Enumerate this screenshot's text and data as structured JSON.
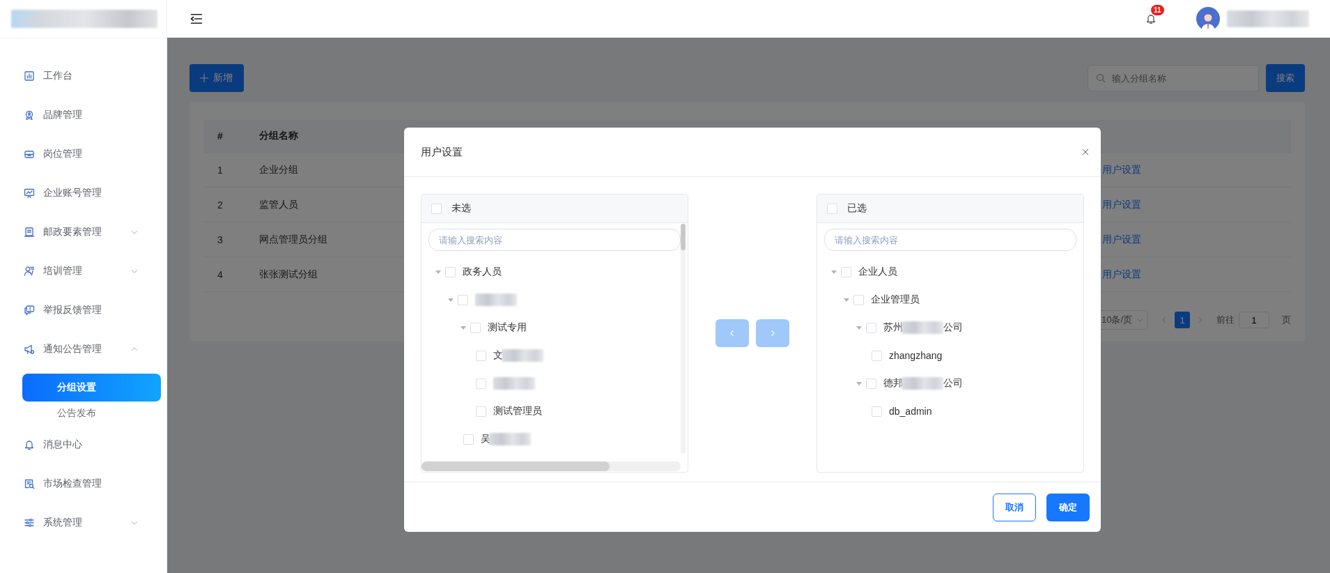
{
  "sidebar": {
    "logo": {
      "redacted": true
    },
    "items": [
      {
        "label": "工作台",
        "selected": false
      },
      {
        "label": "品牌管理",
        "selected": false
      },
      {
        "label": "岗位管理",
        "selected": false
      },
      {
        "label": "企业账号管理",
        "selected": false
      },
      {
        "label": "邮政要素管理",
        "selected": false,
        "expanded": false
      },
      {
        "label": "培训管理",
        "selected": false,
        "expanded": false
      },
      {
        "label": "举报反馈管理",
        "selected": false
      },
      {
        "label": "通知公告管理",
        "selected": false,
        "expanded": true,
        "children": [
          {
            "label": "分组设置",
            "selected": true
          },
          {
            "label": "公告发布",
            "selected": false
          }
        ]
      },
      {
        "label": "消息中心",
        "selected": false
      },
      {
        "label": "市场检查管理",
        "selected": false
      },
      {
        "label": "系统管理",
        "selected": false,
        "expanded": false
      }
    ]
  },
  "topbar": {
    "notification_count": "11",
    "user": {
      "redacted": true
    }
  },
  "toolbar": {
    "add_button": "新增",
    "search": {
      "placeholder": "输入分组名称"
    },
    "search_button": "搜索"
  },
  "table": {
    "columns": [
      "#",
      "分组名称"
    ],
    "rows": [
      {
        "index": "1",
        "name": "企业分组",
        "action": "用户设置"
      },
      {
        "index": "2",
        "name": "监管人员",
        "action": "用户设置"
      },
      {
        "index": "3",
        "name": "网点管理员分组",
        "action": "用户设置"
      },
      {
        "index": "4",
        "name": "张张测试分组",
        "action": "用户设置"
      }
    ]
  },
  "pagination": {
    "page_size": "10条/页",
    "pages": [
      {
        "label": "1",
        "selected": true
      }
    ],
    "goto_label": "前往",
    "goto_value": "1",
    "page_suffix": "页"
  },
  "dialog": {
    "title": "用户设置",
    "source": {
      "title": "未选",
      "checked": false,
      "search_placeholder": "请输入搜索内容",
      "tree": [
        {
          "label": "政务人员",
          "checked": false,
          "expanded": true,
          "children": [
            {
              "redacted": true,
              "checked": false,
              "expanded": true,
              "children": [
                {
                  "label": "测试专用",
                  "checked": false,
                  "expanded": true,
                  "children": [
                    {
                      "label_start": "文",
                      "redacted": true,
                      "checked": false
                    },
                    {
                      "redacted": true,
                      "checked": false
                    },
                    {
                      "label": "测试管理员",
                      "checked": false
                    }
                  ]
                },
                {
                  "label_start": "吴",
                  "redacted": true,
                  "checked": false
                }
              ]
            }
          ]
        }
      ]
    },
    "move_left": {
      "disabled": true
    },
    "move_right": {
      "disabled": true
    },
    "target": {
      "title": "已选",
      "checked": false,
      "search_placeholder": "请输入搜索内容",
      "tree": [
        {
          "label": "企业人员",
          "checked": false,
          "expanded": true,
          "children": [
            {
              "label": "企业管理员",
              "checked": false,
              "expanded": true,
              "children": [
                {
                  "label_start": "苏州",
                  "redacted": true,
                  "label_end": "公司",
                  "checked": false,
                  "expanded": true,
                  "children": [
                    {
                      "label": "zhangzhang",
                      "checked": false
                    }
                  ]
                },
                {
                  "label_start": "德邦",
                  "redacted": true,
                  "label_end": "公司",
                  "checked": false,
                  "expanded": true,
                  "children": [
                    {
                      "label": "db_admin",
                      "checked": false
                    }
                  ]
                }
              ]
            }
          ]
        }
      ]
    },
    "buttons": [
      {
        "label": "取消",
        "kind": "secondary"
      },
      {
        "label": "确定",
        "kind": "primary"
      }
    ]
  }
}
